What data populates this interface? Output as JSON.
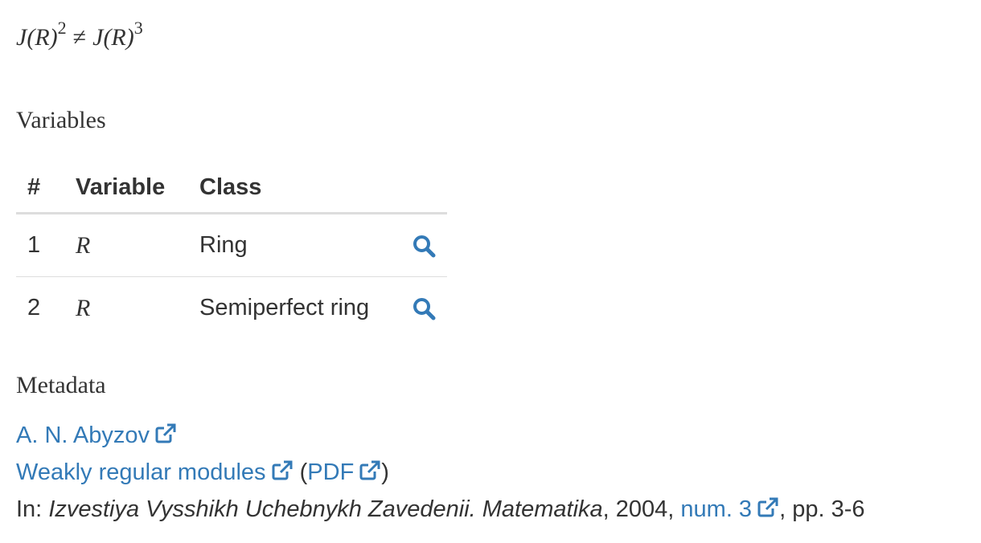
{
  "formula": {
    "lhs_base": "J",
    "lhs_arg": "(R)",
    "lhs_exp": "2",
    "relation": "≠",
    "rhs_base": "J",
    "rhs_arg": "(R)",
    "rhs_exp": "3"
  },
  "variables_section": {
    "title": "Variables",
    "columns": [
      "#",
      "Variable",
      "Class"
    ],
    "rows": [
      {
        "num": "1",
        "variable": "R",
        "class": "Ring"
      },
      {
        "num": "2",
        "variable": "R",
        "class": "Semiperfect ring"
      }
    ]
  },
  "metadata_section": {
    "title": "Metadata",
    "author": "A. N. Abyzov",
    "paper_title": "Weakly regular modules",
    "pdf_open": "(",
    "pdf_label": "PDF",
    "pdf_close": ")",
    "in_prefix": "In: ",
    "journal": "Izvestiya Vysshikh Uchebnykh Zavedenii. Matematika",
    "year_text": ", 2004, ",
    "issue": "num. 3",
    "pages_text": ", pp. 3-6"
  },
  "colors": {
    "link": "#337ab7",
    "text": "#333333",
    "rule": "#dddddd"
  },
  "icons": [
    "search-icon",
    "external-link-icon"
  ]
}
